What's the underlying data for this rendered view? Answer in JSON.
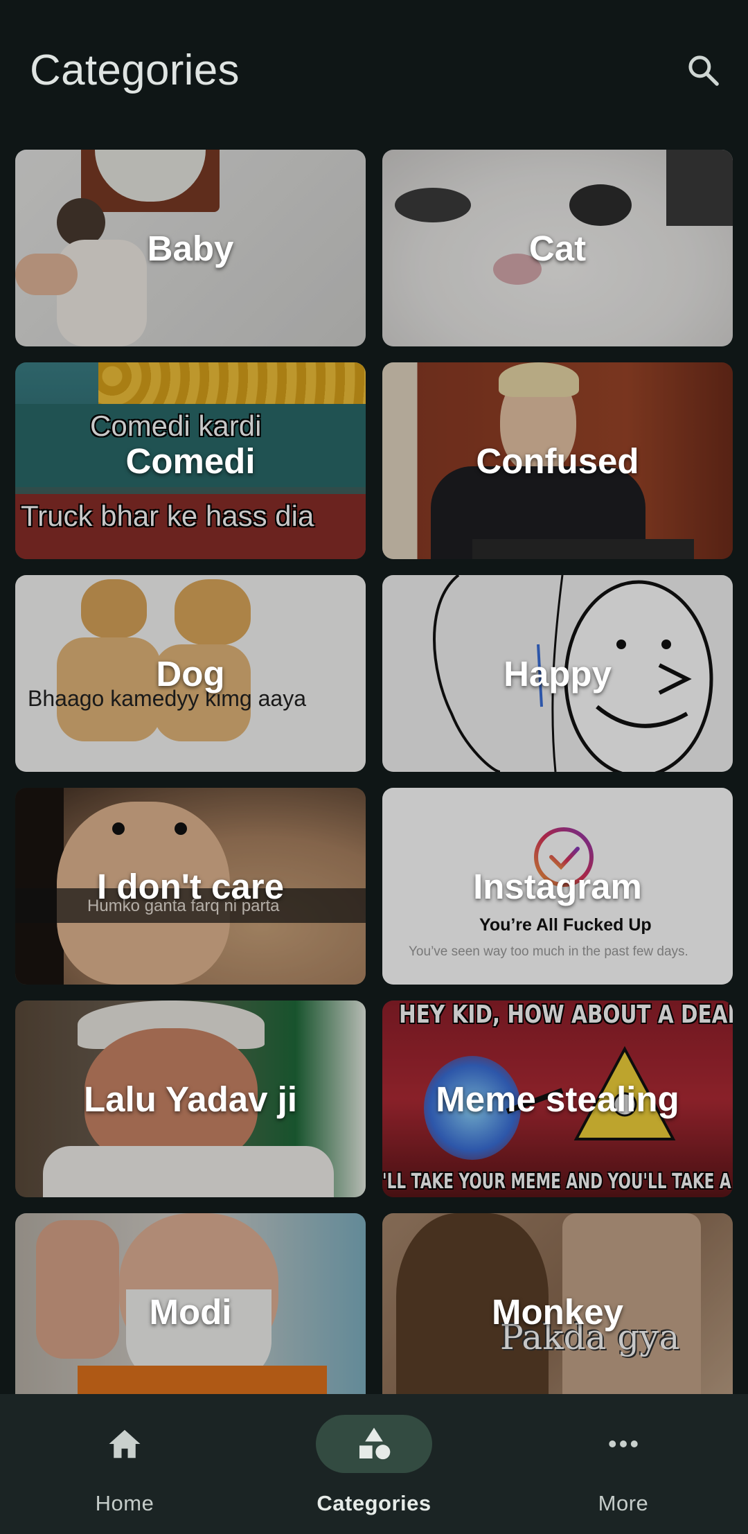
{
  "header": {
    "title": "Categories"
  },
  "categories": [
    {
      "label": "Baby"
    },
    {
      "label": "Cat"
    },
    {
      "label": "Comedi",
      "captions": [
        "Comedi kardi",
        "Truck bhar ke hass dia"
      ]
    },
    {
      "label": "Confused"
    },
    {
      "label": "Dog",
      "captions": [
        "Bhaago kamedyy kimg aaya"
      ]
    },
    {
      "label": "Happy"
    },
    {
      "label": "I don't care",
      "captions": [
        "Humko ganta farq ni parta"
      ]
    },
    {
      "label": "Instagram",
      "captions": [
        "You’re All Fucked Up",
        "You’ve seen way too much in the past few days."
      ]
    },
    {
      "label": "Lalu Yadav ji"
    },
    {
      "label": "Meme stealing",
      "captions": [
        "HEY KID, HOW ABOUT A DEAL?",
        "'LL TAKE YOUR MEME AND YOU'LL TAKE A HIK!"
      ]
    },
    {
      "label": "Modi"
    },
    {
      "label": "Monkey",
      "captions": [
        "Pakda gya"
      ]
    }
  ],
  "bottom_nav": {
    "items": [
      {
        "label": "Home",
        "icon": "home-icon",
        "active": false
      },
      {
        "label": "Categories",
        "icon": "category-icon",
        "active": true
      },
      {
        "label": "More",
        "icon": "more-horiz-icon",
        "active": false
      }
    ]
  },
  "colors": {
    "background": "#0f1616",
    "nav_background": "#1b2424",
    "nav_active_pill": "#334b41",
    "text_primary": "#dfe4e2"
  }
}
